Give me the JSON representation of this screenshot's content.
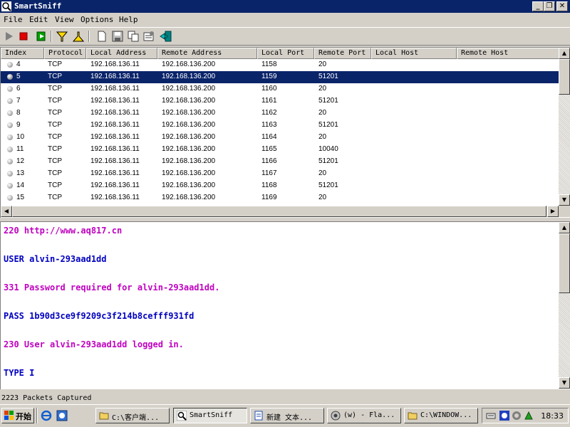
{
  "window": {
    "title": "SmartSniff"
  },
  "menu": [
    "File",
    "Edit",
    "View",
    "Options",
    "Help"
  ],
  "toolbar": {
    "icons": [
      "start-capture-icon",
      "stop-capture-icon",
      "capture-options-icon",
      "filter-icon",
      "filter-clear-icon",
      "new-icon",
      "save-icon",
      "copy-icon",
      "properties-icon",
      "exit-icon"
    ]
  },
  "packet_list": {
    "columns": [
      "Index",
      "Protocol",
      "Local Address",
      "Remote Address",
      "Local Port",
      "Remote Port",
      "Local Host",
      "Remote Host"
    ],
    "rows": [
      {
        "index": "4",
        "protocol": "TCP",
        "local_address": "192.168.136.11",
        "remote_address": "192.168.136.200",
        "local_port": "1158",
        "remote_port": "20",
        "selected": false
      },
      {
        "index": "5",
        "protocol": "TCP",
        "local_address": "192.168.136.11",
        "remote_address": "192.168.136.200",
        "local_port": "1159",
        "remote_port": "51201",
        "selected": true
      },
      {
        "index": "6",
        "protocol": "TCP",
        "local_address": "192.168.136.11",
        "remote_address": "192.168.136.200",
        "local_port": "1160",
        "remote_port": "20",
        "selected": false
      },
      {
        "index": "7",
        "protocol": "TCP",
        "local_address": "192.168.136.11",
        "remote_address": "192.168.136.200",
        "local_port": "1161",
        "remote_port": "51201",
        "selected": false
      },
      {
        "index": "8",
        "protocol": "TCP",
        "local_address": "192.168.136.11",
        "remote_address": "192.168.136.200",
        "local_port": "1162",
        "remote_port": "20",
        "selected": false
      },
      {
        "index": "9",
        "protocol": "TCP",
        "local_address": "192.168.136.11",
        "remote_address": "192.168.136.200",
        "local_port": "1163",
        "remote_port": "51201",
        "selected": false
      },
      {
        "index": "10",
        "protocol": "TCP",
        "local_address": "192.168.136.11",
        "remote_address": "192.168.136.200",
        "local_port": "1164",
        "remote_port": "20",
        "selected": false
      },
      {
        "index": "11",
        "protocol": "TCP",
        "local_address": "192.168.136.11",
        "remote_address": "192.168.136.200",
        "local_port": "1165",
        "remote_port": "10040",
        "selected": false
      },
      {
        "index": "12",
        "protocol": "TCP",
        "local_address": "192.168.136.11",
        "remote_address": "192.168.136.200",
        "local_port": "1166",
        "remote_port": "51201",
        "selected": false
      },
      {
        "index": "13",
        "protocol": "TCP",
        "local_address": "192.168.136.11",
        "remote_address": "192.168.136.200",
        "local_port": "1167",
        "remote_port": "20",
        "selected": false
      },
      {
        "index": "14",
        "protocol": "TCP",
        "local_address": "192.168.136.11",
        "remote_address": "192.168.136.200",
        "local_port": "1168",
        "remote_port": "51201",
        "selected": false
      },
      {
        "index": "15",
        "protocol": "TCP",
        "local_address": "192.168.136.11",
        "remote_address": "192.168.136.200",
        "local_port": "1169",
        "remote_port": "20",
        "selected": false
      }
    ]
  },
  "detail": {
    "lines": [
      {
        "text": "220 http://www.aq817.cn",
        "dir": "remote"
      },
      {
        "text": "USER alvin-293aad1dd",
        "dir": "local"
      },
      {
        "text": "331 Password required for alvin-293aad1dd.",
        "dir": "remote"
      },
      {
        "text": "PASS 1b90d3ce9f9209c3f214b8cefff931fd",
        "dir": "local"
      },
      {
        "text": "230 User alvin-293aad1dd logged in.",
        "dir": "remote"
      },
      {
        "text": "TYPE I",
        "dir": "local"
      }
    ]
  },
  "status": {
    "text": "2223 Packets Captured"
  },
  "taskbar": {
    "start_label": "开始",
    "tasks": [
      {
        "label": "C:\\客户端...",
        "icon": "folder-icon",
        "active": false
      },
      {
        "label": "SmartSniff",
        "icon": "smartsniff-icon",
        "active": true
      },
      {
        "label": "新建 文本...",
        "icon": "notepad-icon",
        "active": false
      },
      {
        "label": "(w) - Fla...",
        "icon": "ftp-client-icon",
        "active": false
      },
      {
        "label": "C:\\WINDOW...",
        "icon": "folder-icon",
        "active": false
      }
    ],
    "clock": "18:33"
  },
  "colors": {
    "titlebar": "#0a246a",
    "selection": "#0a246a",
    "remote_text": "#c000c0",
    "local_text": "#0000c0"
  }
}
